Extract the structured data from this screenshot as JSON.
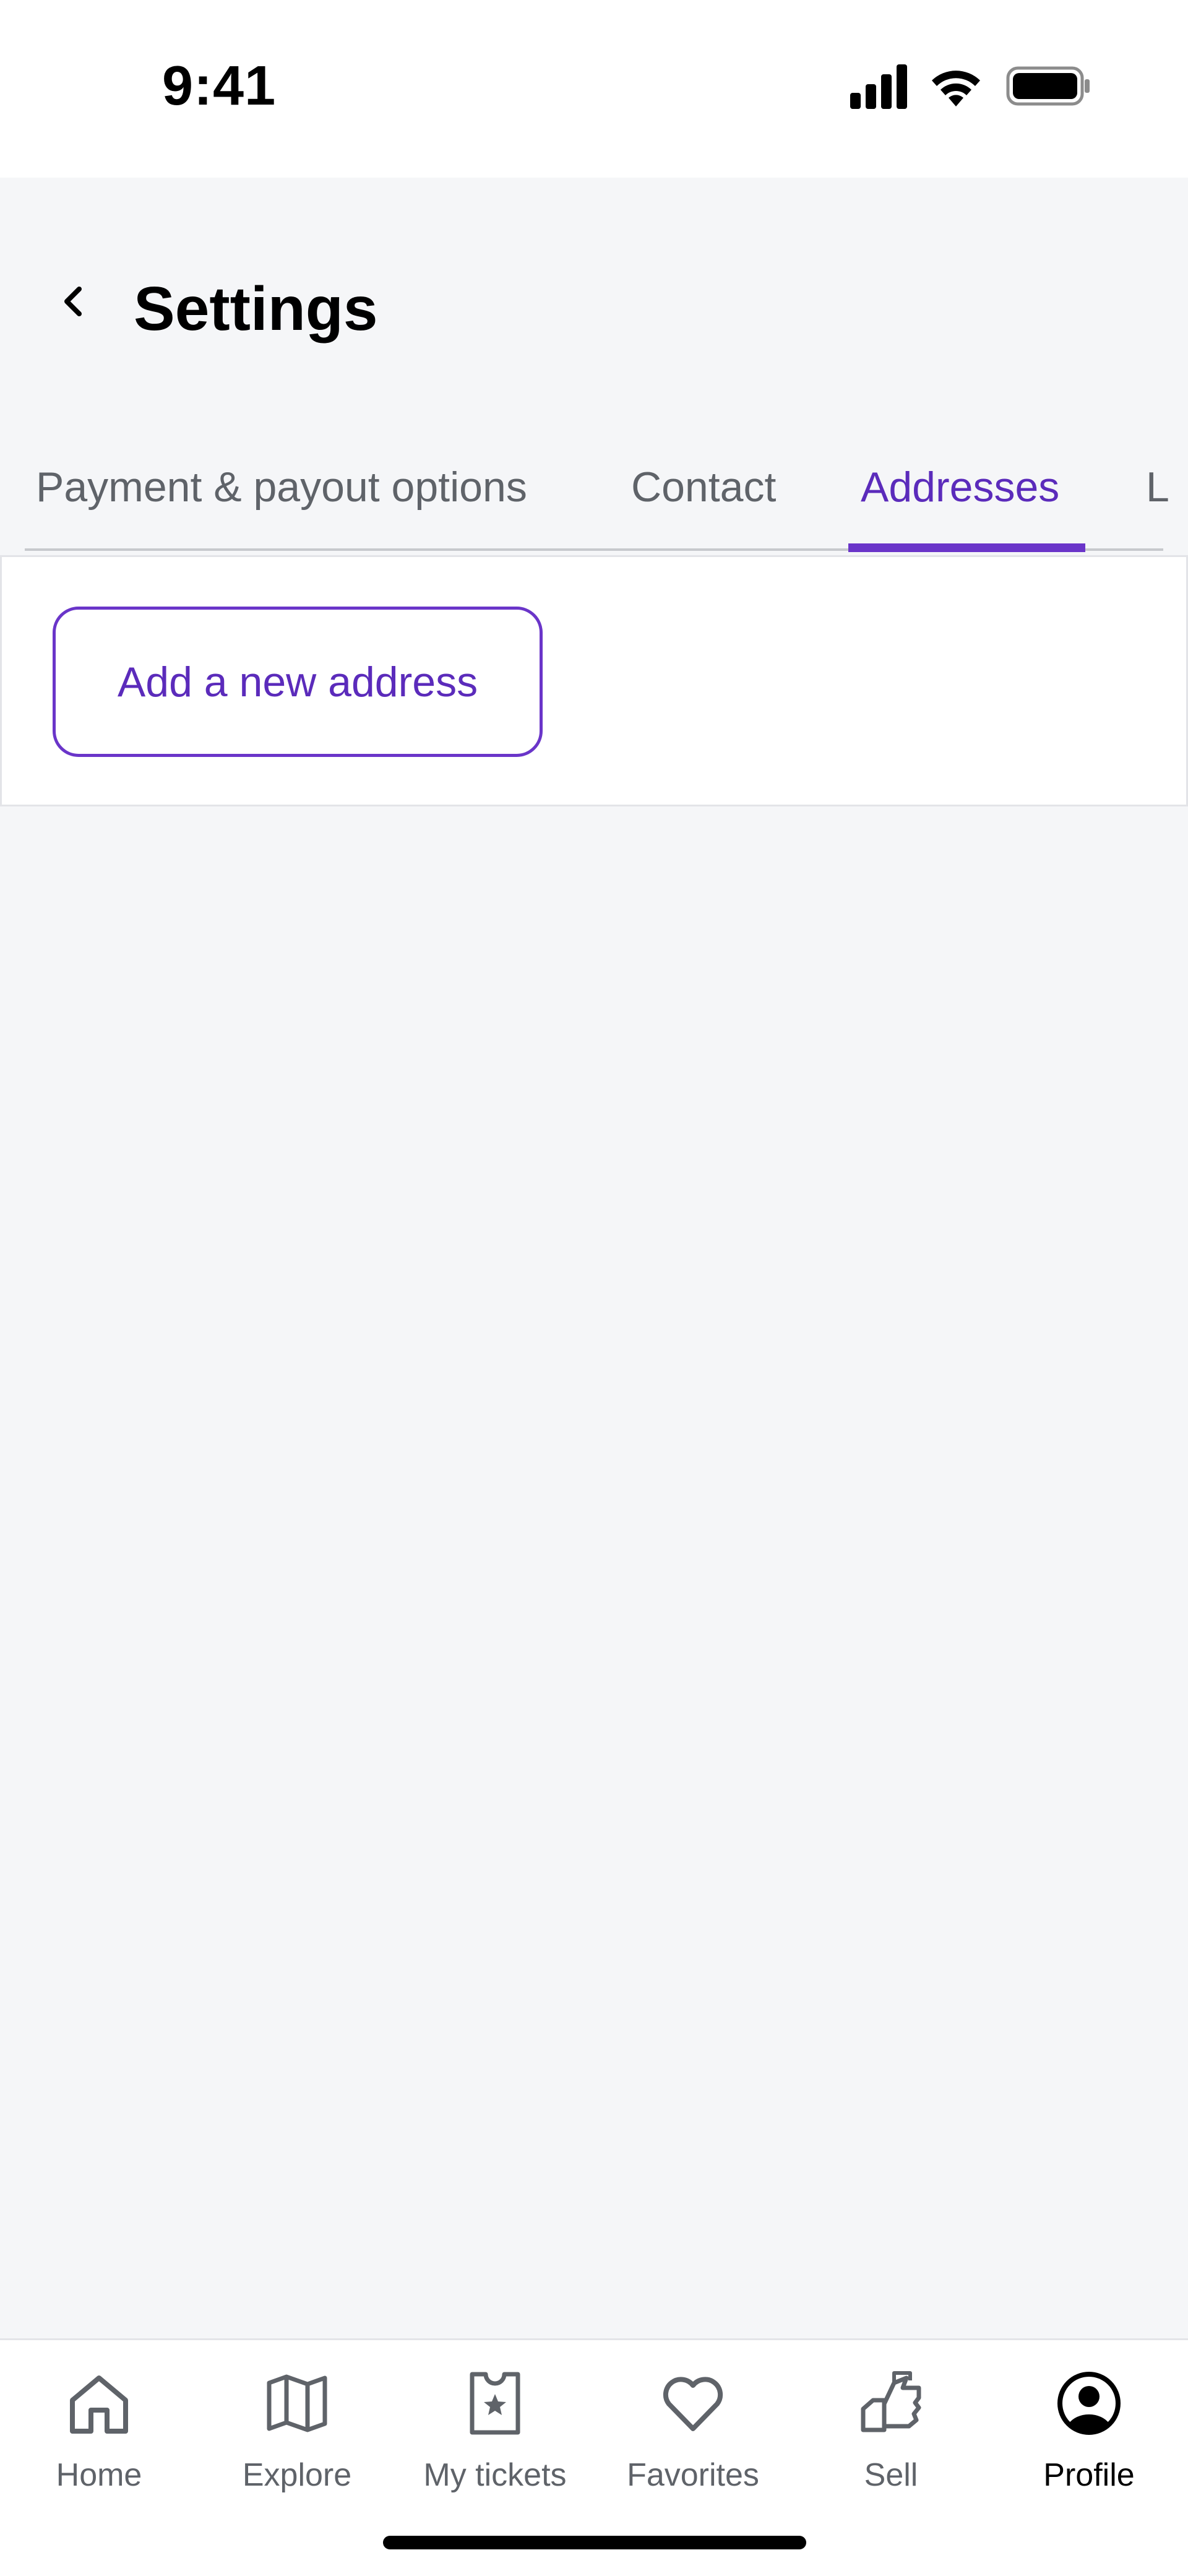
{
  "status_bar": {
    "time": "9:41",
    "icons": [
      "cellular-signal-icon",
      "wifi-icon",
      "battery-icon"
    ]
  },
  "header": {
    "title": "Settings",
    "back_icon": "chevron-left-icon"
  },
  "tabs": [
    {
      "label": "Payment & payout options",
      "active": false
    },
    {
      "label": "Contact",
      "active": false
    },
    {
      "label": "Addresses",
      "active": true
    },
    {
      "label": "L",
      "active": false
    }
  ],
  "addresses": {
    "add_button_label": "Add a new address"
  },
  "bottom_nav": {
    "items": [
      {
        "label": "Home",
        "icon": "home-icon",
        "active": false
      },
      {
        "label": "Explore",
        "icon": "map-icon",
        "active": false
      },
      {
        "label": "My tickets",
        "icon": "ticket-icon",
        "active": false
      },
      {
        "label": "Favorites",
        "icon": "heart-icon",
        "active": false
      },
      {
        "label": "Sell",
        "icon": "sell-hand-icon",
        "active": false
      },
      {
        "label": "Profile",
        "icon": "profile-icon",
        "active": true
      }
    ]
  },
  "colors": {
    "accent": "#6a35c9",
    "accent_text": "#5b2bbb",
    "background": "#f5f6f8",
    "muted_text": "#5f6369"
  }
}
